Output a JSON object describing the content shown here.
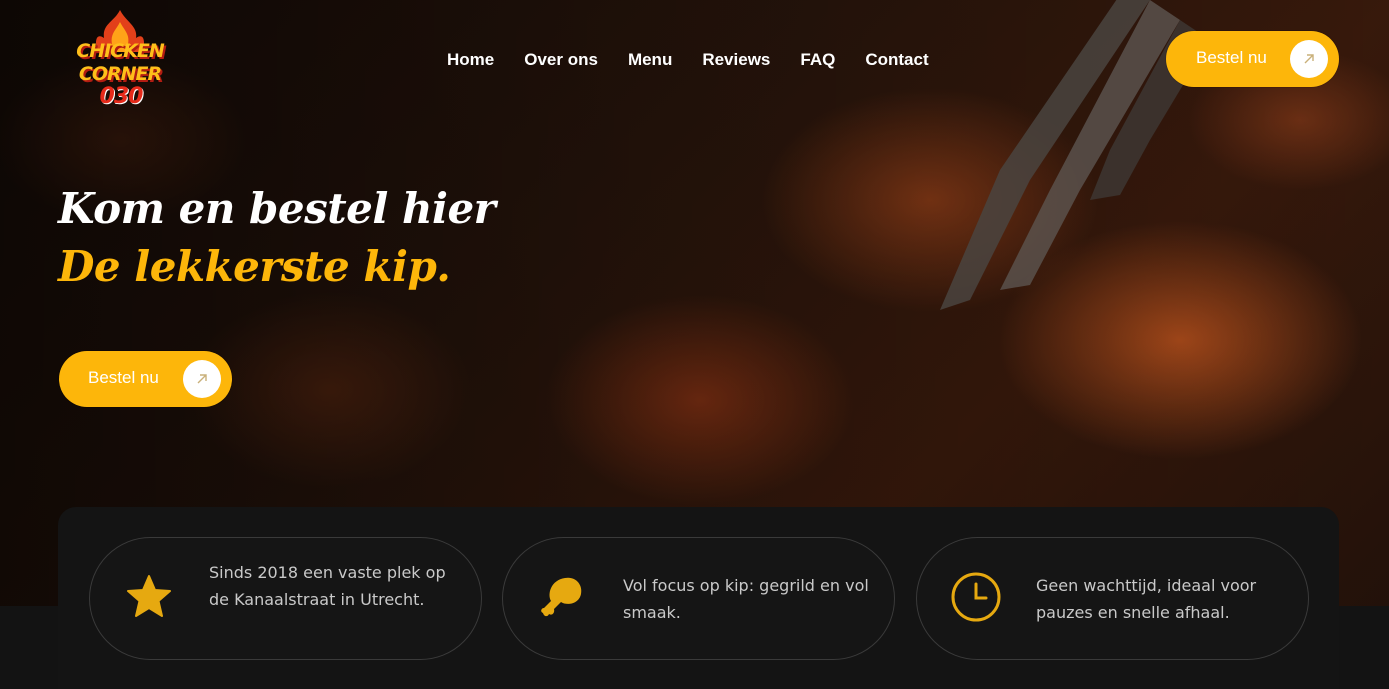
{
  "logo": {
    "line1": "CHICKEN",
    "line2": "CORNER",
    "line3": "030"
  },
  "nav": {
    "items": [
      "Home",
      "Over ons",
      "Menu",
      "Reviews",
      "FAQ",
      "Contact"
    ]
  },
  "header_cta": {
    "label": "Bestel nu",
    "icon": "arrow-up-right-icon"
  },
  "hero": {
    "headline_line1": "Kom en bestel hier",
    "headline_line2": "De lekkerste kip.",
    "cta_label": "Bestel nu",
    "cta_icon": "arrow-up-right-icon"
  },
  "features": [
    {
      "icon": "star-icon",
      "text": "Sinds 2018 een vaste plek op de Kanaalstraat in Utrecht."
    },
    {
      "icon": "chicken-leg-icon",
      "text": "Vol focus op kip: gegrild en vol smaak."
    },
    {
      "icon": "clock-icon",
      "text": "Geen wachttijd, ideaal voor pauzes en snelle afhaal."
    }
  ],
  "colors": {
    "accent": "#fdb60a",
    "background": "#131313",
    "card_border": "#3a3a3a",
    "text_muted": "#c9c9c9"
  }
}
